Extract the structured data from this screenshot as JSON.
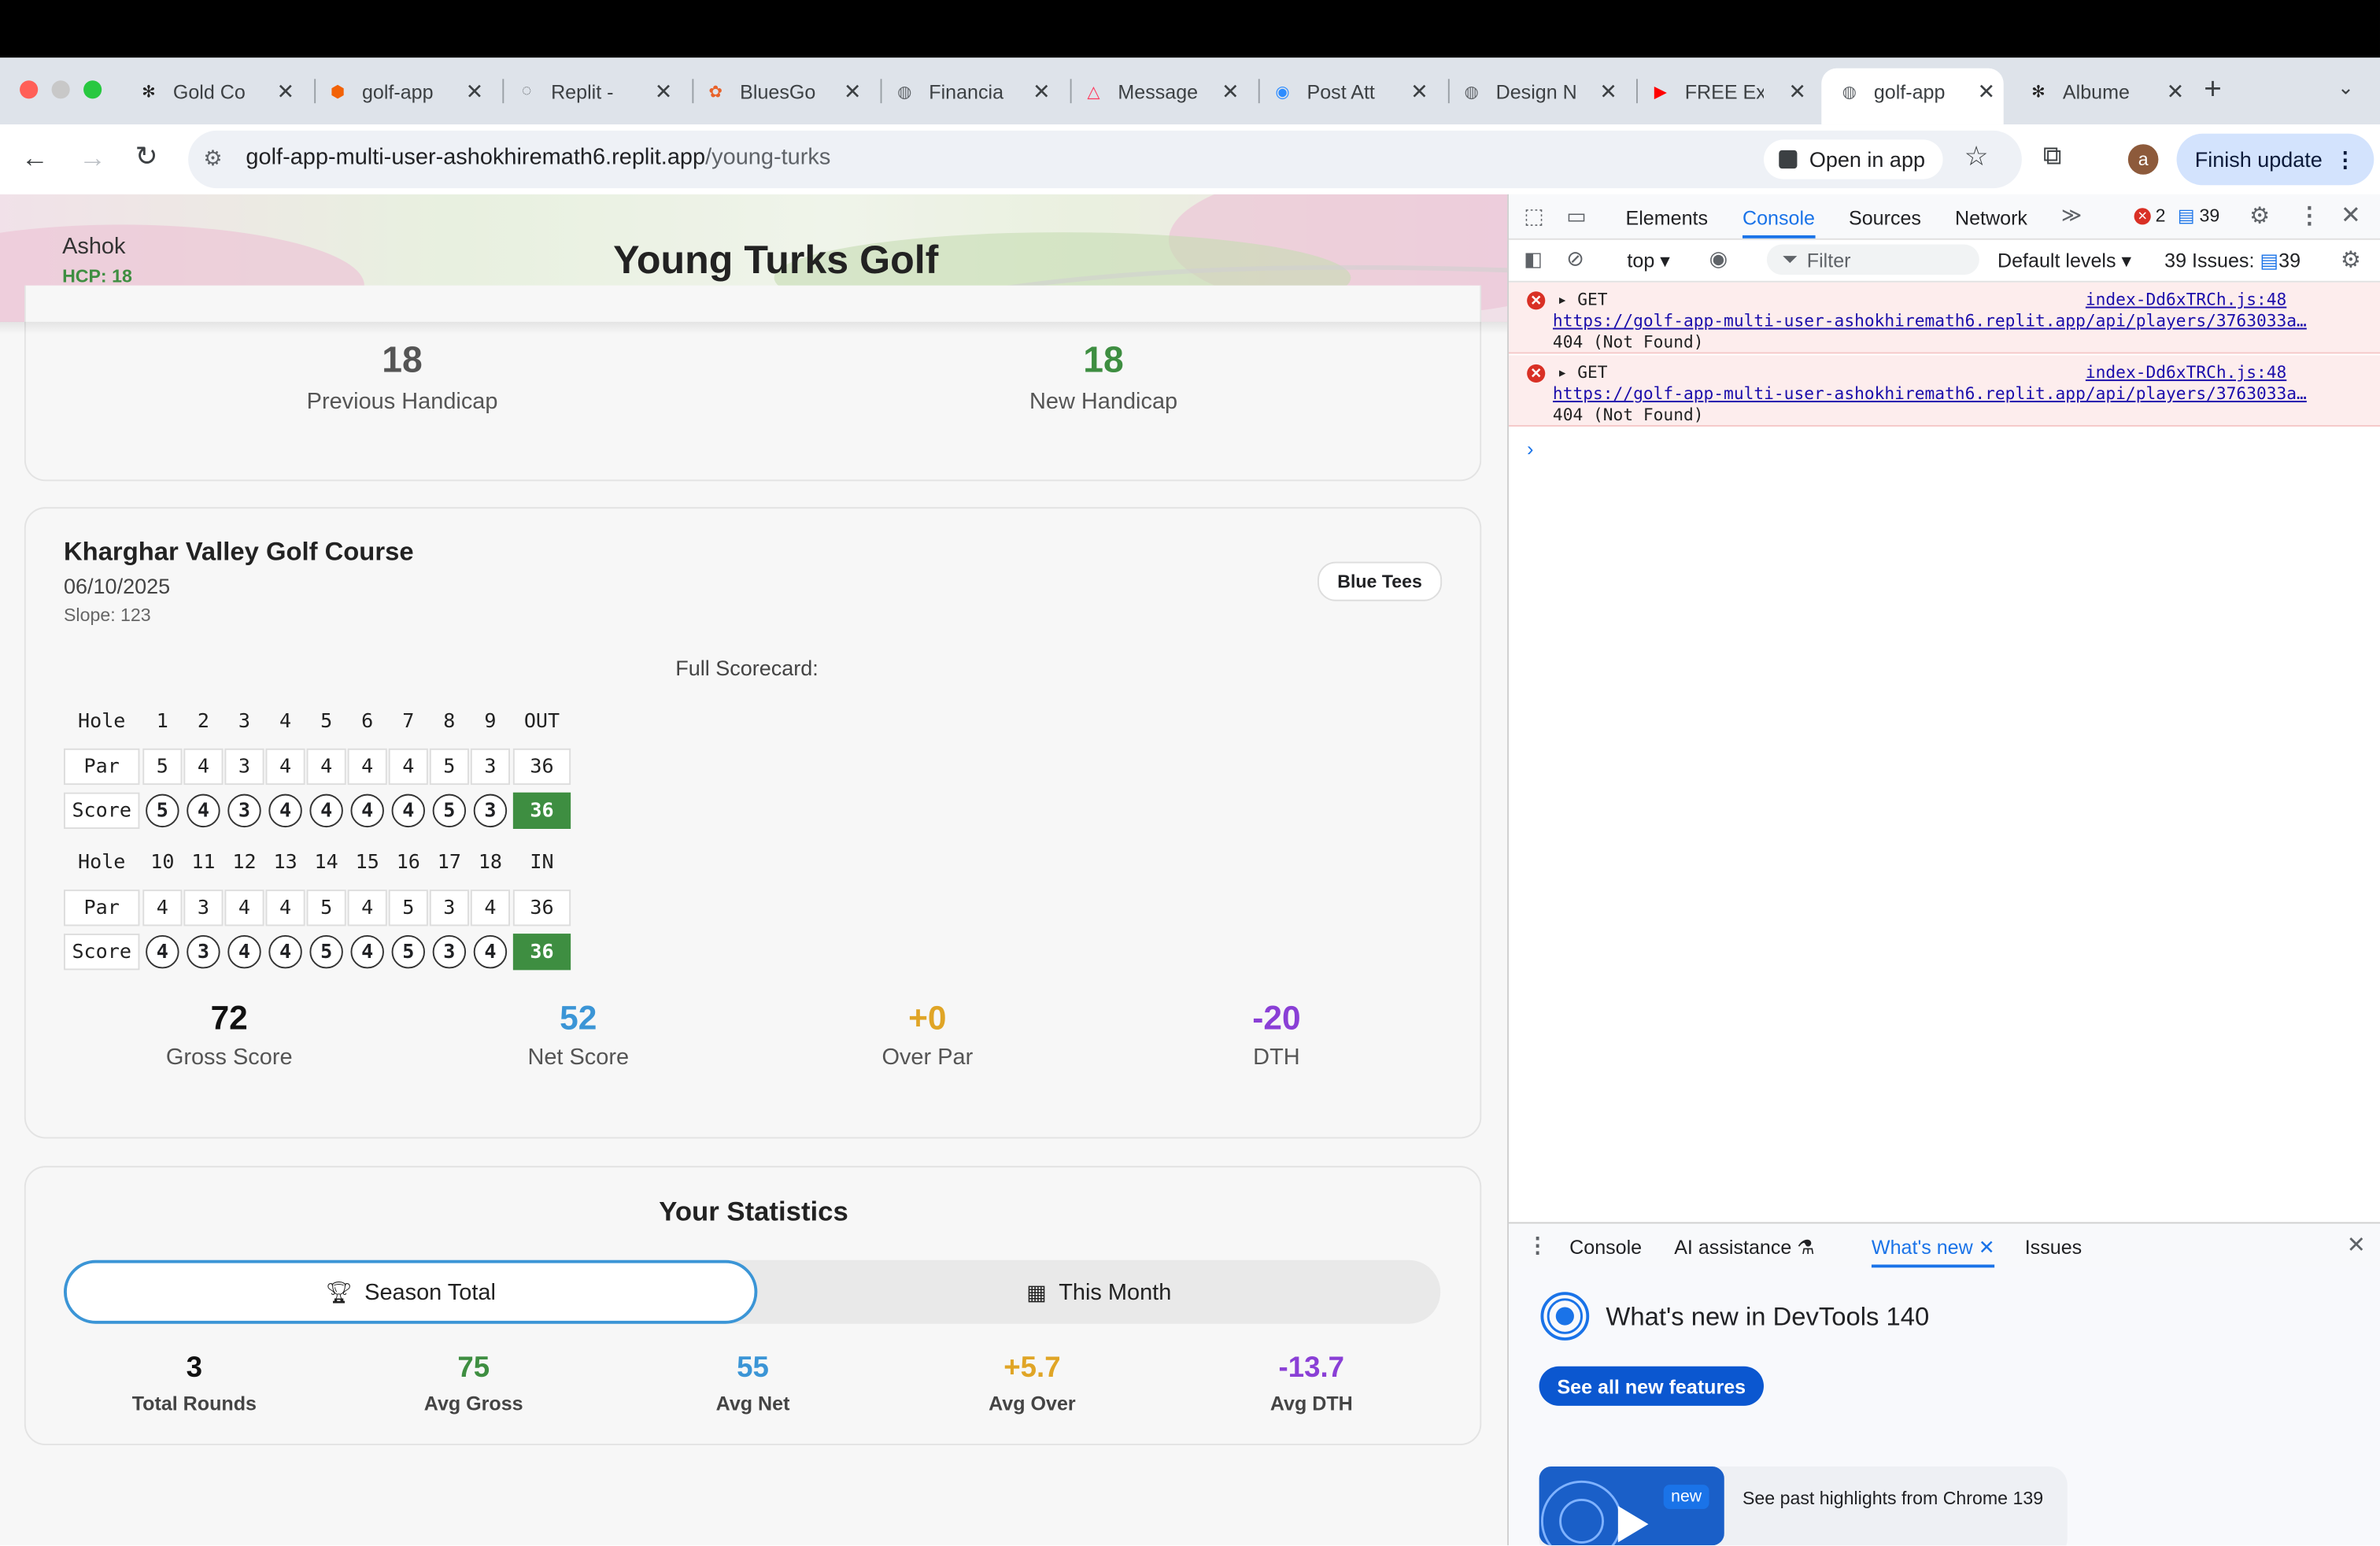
{
  "browser": {
    "tabs": [
      {
        "title": "Gold Co",
        "icon": "openai-icon"
      },
      {
        "title": "golf-app",
        "icon": "replit-icon"
      },
      {
        "title": "Replit - ",
        "icon": "loading-icon"
      },
      {
        "title": "BluesGo",
        "icon": "bluesgolf-icon"
      },
      {
        "title": "Financia",
        "icon": "globe-icon"
      },
      {
        "title": "Message",
        "icon": "airbnb-icon"
      },
      {
        "title": "Post Att",
        "icon": "zoom-icon"
      },
      {
        "title": "Design N",
        "icon": "globe-icon"
      },
      {
        "title": "FREE Ex",
        "icon": "youtube-icon"
      },
      {
        "title": "golf-app",
        "icon": "globe-icon",
        "active": true
      },
      {
        "title": "Albume",
        "icon": "openai-icon"
      }
    ],
    "url_host": "golf-app-multi-user-ashokhiremath6.replit.app",
    "url_path": "/young-turks",
    "open_in_app": "Open in app",
    "finish_update": "Finish update",
    "profile_initial": "a"
  },
  "app": {
    "title": "Young Turks Golf",
    "user_name": "Ashok",
    "user_hcp": "HCP: 18"
  },
  "handicap": {
    "previous_value": "18",
    "previous_label": "Previous Handicap",
    "new_value": "18",
    "new_label": "New Handicap"
  },
  "round": {
    "course": "Kharghar Valley Golf Course",
    "date": "06/10/2025",
    "slope": "Slope: 123",
    "tees": "Blue Tees",
    "scorecard_title": "Full Scorecard:",
    "front": {
      "hole_label": "Hole",
      "holes": [
        "1",
        "2",
        "3",
        "4",
        "5",
        "6",
        "7",
        "8",
        "9"
      ],
      "total_label": "OUT",
      "par_label": "Par",
      "par": [
        "5",
        "4",
        "3",
        "4",
        "4",
        "4",
        "4",
        "5",
        "3"
      ],
      "par_total": "36",
      "score_label": "Score",
      "score": [
        "5",
        "4",
        "3",
        "4",
        "4",
        "4",
        "4",
        "5",
        "3"
      ],
      "score_total": "36"
    },
    "back": {
      "hole_label": "Hole",
      "holes": [
        "10",
        "11",
        "12",
        "13",
        "14",
        "15",
        "16",
        "17",
        "18"
      ],
      "total_label": "IN",
      "par_label": "Par",
      "par": [
        "4",
        "3",
        "4",
        "4",
        "5",
        "4",
        "5",
        "3",
        "4"
      ],
      "par_total": "36",
      "score_label": "Score",
      "score": [
        "4",
        "3",
        "4",
        "4",
        "5",
        "4",
        "5",
        "3",
        "4"
      ],
      "score_total": "36"
    },
    "summary": [
      {
        "value": "72",
        "label": "Gross Score",
        "color": "#111111"
      },
      {
        "value": "52",
        "label": "Net Score",
        "color": "#3b95d6"
      },
      {
        "value": "+0",
        "label": "Over Par",
        "color": "#e0a526"
      },
      {
        "value": "-20",
        "label": "DTH",
        "color": "#8a3fd6"
      }
    ]
  },
  "stats": {
    "title": "Your Statistics",
    "tab_season": "Season Total",
    "tab_month": "This Month",
    "items": [
      {
        "value": "3",
        "label": "Total Rounds",
        "color": "#111111"
      },
      {
        "value": "75",
        "label": "Avg Gross",
        "color": "#3e8e41"
      },
      {
        "value": "55",
        "label": "Avg Net",
        "color": "#3b95d6"
      },
      {
        "value": "+5.7",
        "label": "Avg Over",
        "color": "#e0a526"
      },
      {
        "value": "-13.7",
        "label": "Avg DTH",
        "color": "#8a3fd6"
      }
    ]
  },
  "devtools": {
    "tabs": [
      "Elements",
      "Console",
      "Sources",
      "Network"
    ],
    "active_tab": "Console",
    "error_count": "2",
    "message_count": "39",
    "context": "top",
    "filter_placeholder": "Filter",
    "levels": "Default levels",
    "issues_label": "39 Issues:",
    "issues_count": "39",
    "errors": [
      {
        "method": "GET",
        "source": "index-Dd6xTRCh.js:48",
        "url": "https://golf-app-multi-user-ashokhiremath6.replit.app/api/players/3763033a…",
        "status": "404 (Not Found)"
      },
      {
        "method": "GET",
        "source": "index-Dd6xTRCh.js:48",
        "url": "https://golf-app-multi-user-ashokhiremath6.replit.app/api/players/3763033a…",
        "status": "404 (Not Found)"
      }
    ],
    "drawer_tabs": [
      "Console",
      "AI assistance",
      "What's new",
      "Issues"
    ],
    "whats_new_title": "What's new in DevTools 140",
    "see_all": "See all new features",
    "highlight_badge": "new",
    "highlight_text": "See past highlights from Chrome 139"
  }
}
